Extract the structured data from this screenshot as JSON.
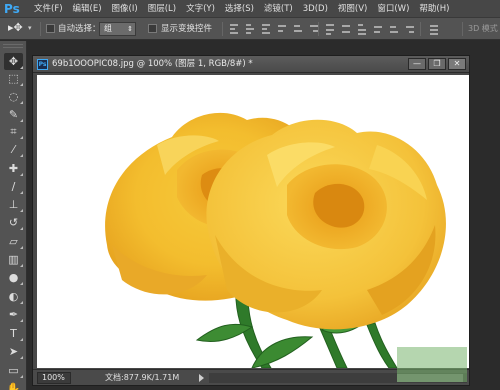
{
  "app": {
    "logo": "Ps",
    "accent_color": "#3fa9f5"
  },
  "menu": {
    "items": [
      {
        "label": "文件(F)"
      },
      {
        "label": "编辑(E)"
      },
      {
        "label": "图像(I)"
      },
      {
        "label": "图层(L)"
      },
      {
        "label": "文字(Y)"
      },
      {
        "label": "选择(S)"
      },
      {
        "label": "滤镜(T)"
      },
      {
        "label": "3D(D)"
      },
      {
        "label": "视图(V)"
      },
      {
        "label": "窗口(W)"
      },
      {
        "label": "帮助(H)"
      }
    ]
  },
  "options": {
    "tool_icon": "move-tool-icon",
    "auto_select_label": "自动选择：",
    "auto_select_value": "组",
    "show_transform_label": "显示变换控件",
    "mode_3d_label": "3D 模式"
  },
  "tools": [
    {
      "name": "move-tool-icon",
      "glyph": "✥",
      "active": true
    },
    {
      "name": "marquee-tool-icon",
      "glyph": "⬚"
    },
    {
      "name": "lasso-tool-icon",
      "glyph": "◌"
    },
    {
      "name": "quick-select-tool-icon",
      "glyph": "✎"
    },
    {
      "name": "crop-tool-icon",
      "glyph": "⌗"
    },
    {
      "name": "eyedropper-tool-icon",
      "glyph": "⁄"
    },
    {
      "name": "healing-brush-tool-icon",
      "glyph": "✚"
    },
    {
      "name": "brush-tool-icon",
      "glyph": "∕"
    },
    {
      "name": "clone-stamp-tool-icon",
      "glyph": "⊥"
    },
    {
      "name": "history-brush-tool-icon",
      "glyph": "↺"
    },
    {
      "name": "eraser-tool-icon",
      "glyph": "▱"
    },
    {
      "name": "gradient-tool-icon",
      "glyph": "▥"
    },
    {
      "name": "blur-tool-icon",
      "glyph": "●"
    },
    {
      "name": "dodge-tool-icon",
      "glyph": "◐"
    },
    {
      "name": "pen-tool-icon",
      "glyph": "✒"
    },
    {
      "name": "type-tool-icon",
      "glyph": "T"
    },
    {
      "name": "path-select-tool-icon",
      "glyph": "➤"
    },
    {
      "name": "shape-tool-icon",
      "glyph": "▭"
    },
    {
      "name": "hand-tool-icon",
      "glyph": "✋"
    }
  ],
  "document": {
    "title": "69b1OOOPIC08.jpg @ 100% (图层 1, RGB/8#) *",
    "ps_badge": "Ps",
    "image_subject": "yellow-roses-photo",
    "window_buttons": [
      "—",
      "❐",
      "✕"
    ],
    "zoom": "100%",
    "doc_info": "文档:877.9K/1.71M"
  }
}
